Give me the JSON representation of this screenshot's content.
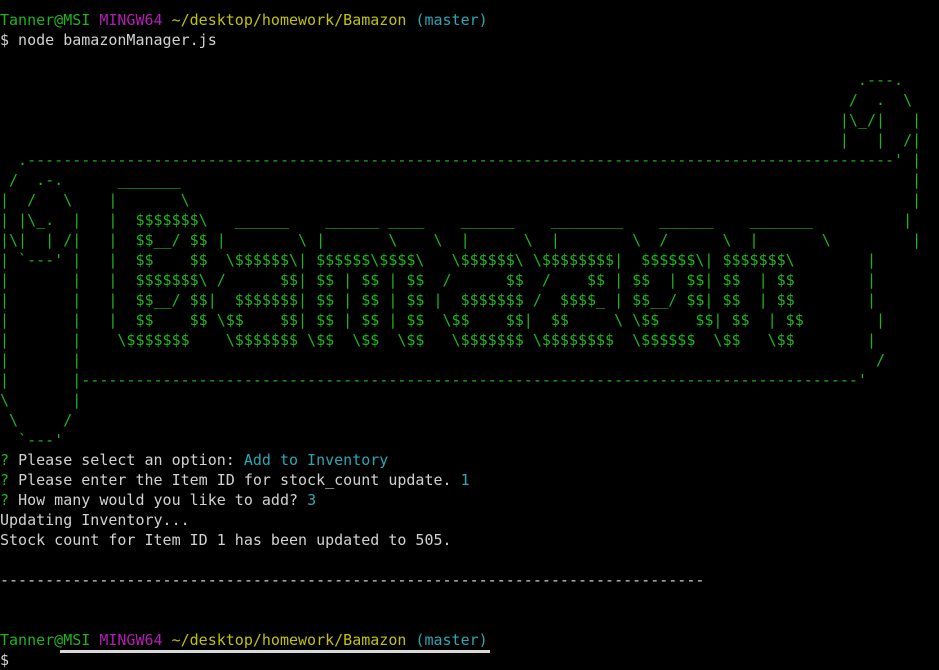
{
  "prompt1": {
    "user_host": "Tanner@MSI",
    "system": "MINGW64",
    "path": "~/desktop/homework/Bamazon",
    "branch": "(master)"
  },
  "command": "$ node bamazonManager.js",
  "banner_lines": [
    "                                                                                               .---.",
    "                                                                                              /  .  \\",
    "                                                                                             |\\_/|   |",
    "                                                                                             |   |  /|",
    "  .------------------------------------------------------------------------------------------------' |",
    " /  .-.      _______                                                                                 |",
    "|  /   \\    |       \\                                                                                |",
    "| |\\_.  |   |  $$$$$$$\\   ______    ______ ____    ______    ________    ______    _______          |",
    "|\\|  | /|   |  $$__/ $$ |        \\ |       \\    \\  |      \\  |        \\  /      \\  |       \\         |",
    "| `---' |   |  $$    $$  \\$$$$$$\\| $$$$$$\\$$$$\\   \\$$$$$$\\ \\$$$$$$$$|  $$$$$$\\| $$$$$$$\\        |",
    "|       |   |  $$$$$$$\\ /      $$| $$ | $$ | $$  /      $$  /    $$ | $$  | $$| $$  | $$        |",
    "|       |   |  $$__/ $$|  $$$$$$$| $$ | $$ | $$ |  $$$$$$$ /  $$$$_ | $$__/ $$| $$  | $$        |",
    "|       |   |  $$    $$ \\$$    $$| $$ | $$ | $$  \\$$    $$|  $$     \\ \\$$    $$| $$  | $$        |",
    "|       |    \\$$$$$$$    \\$$$$$$$ \\$$  \\$$  \\$$   \\$$$$$$$ \\$$$$$$$$  \\$$$$$$  \\$$   \\$$        |",
    "|       |                                                                                        /",
    "|       |--------------------------------------------------------------------------------------'",
    "\\       |",
    " \\     /",
    "  `---'"
  ],
  "qa": [
    {
      "mark": "?",
      "question": "Please select an option:",
      "answer": "Add to Inventory"
    },
    {
      "mark": "?",
      "question": "Please enter the Item ID for stock_count update.",
      "answer": "1"
    },
    {
      "mark": "?",
      "question": "How many would you like to add?",
      "answer": "3"
    }
  ],
  "output_lines": [
    "Updating Inventory...",
    "Stock count for Item ID 1 has been updated to 505."
  ],
  "separator": "------------------------------------------------------------------------------",
  "prompt2": {
    "user_host": "Tanner@MSI",
    "system": "MINGW64",
    "path": "~/desktop/homework/Bamazon",
    "branch": "(master)"
  },
  "cursor_prompt": "$",
  "colors": {
    "user_host": "#1fb31f",
    "system": "#b31db3",
    "path": "#c1c10b",
    "branch": "#2aa7b5",
    "art": "#1fb31f",
    "answer": "#2aa7b5",
    "text": "#d2d2d2",
    "background": "#000000"
  }
}
